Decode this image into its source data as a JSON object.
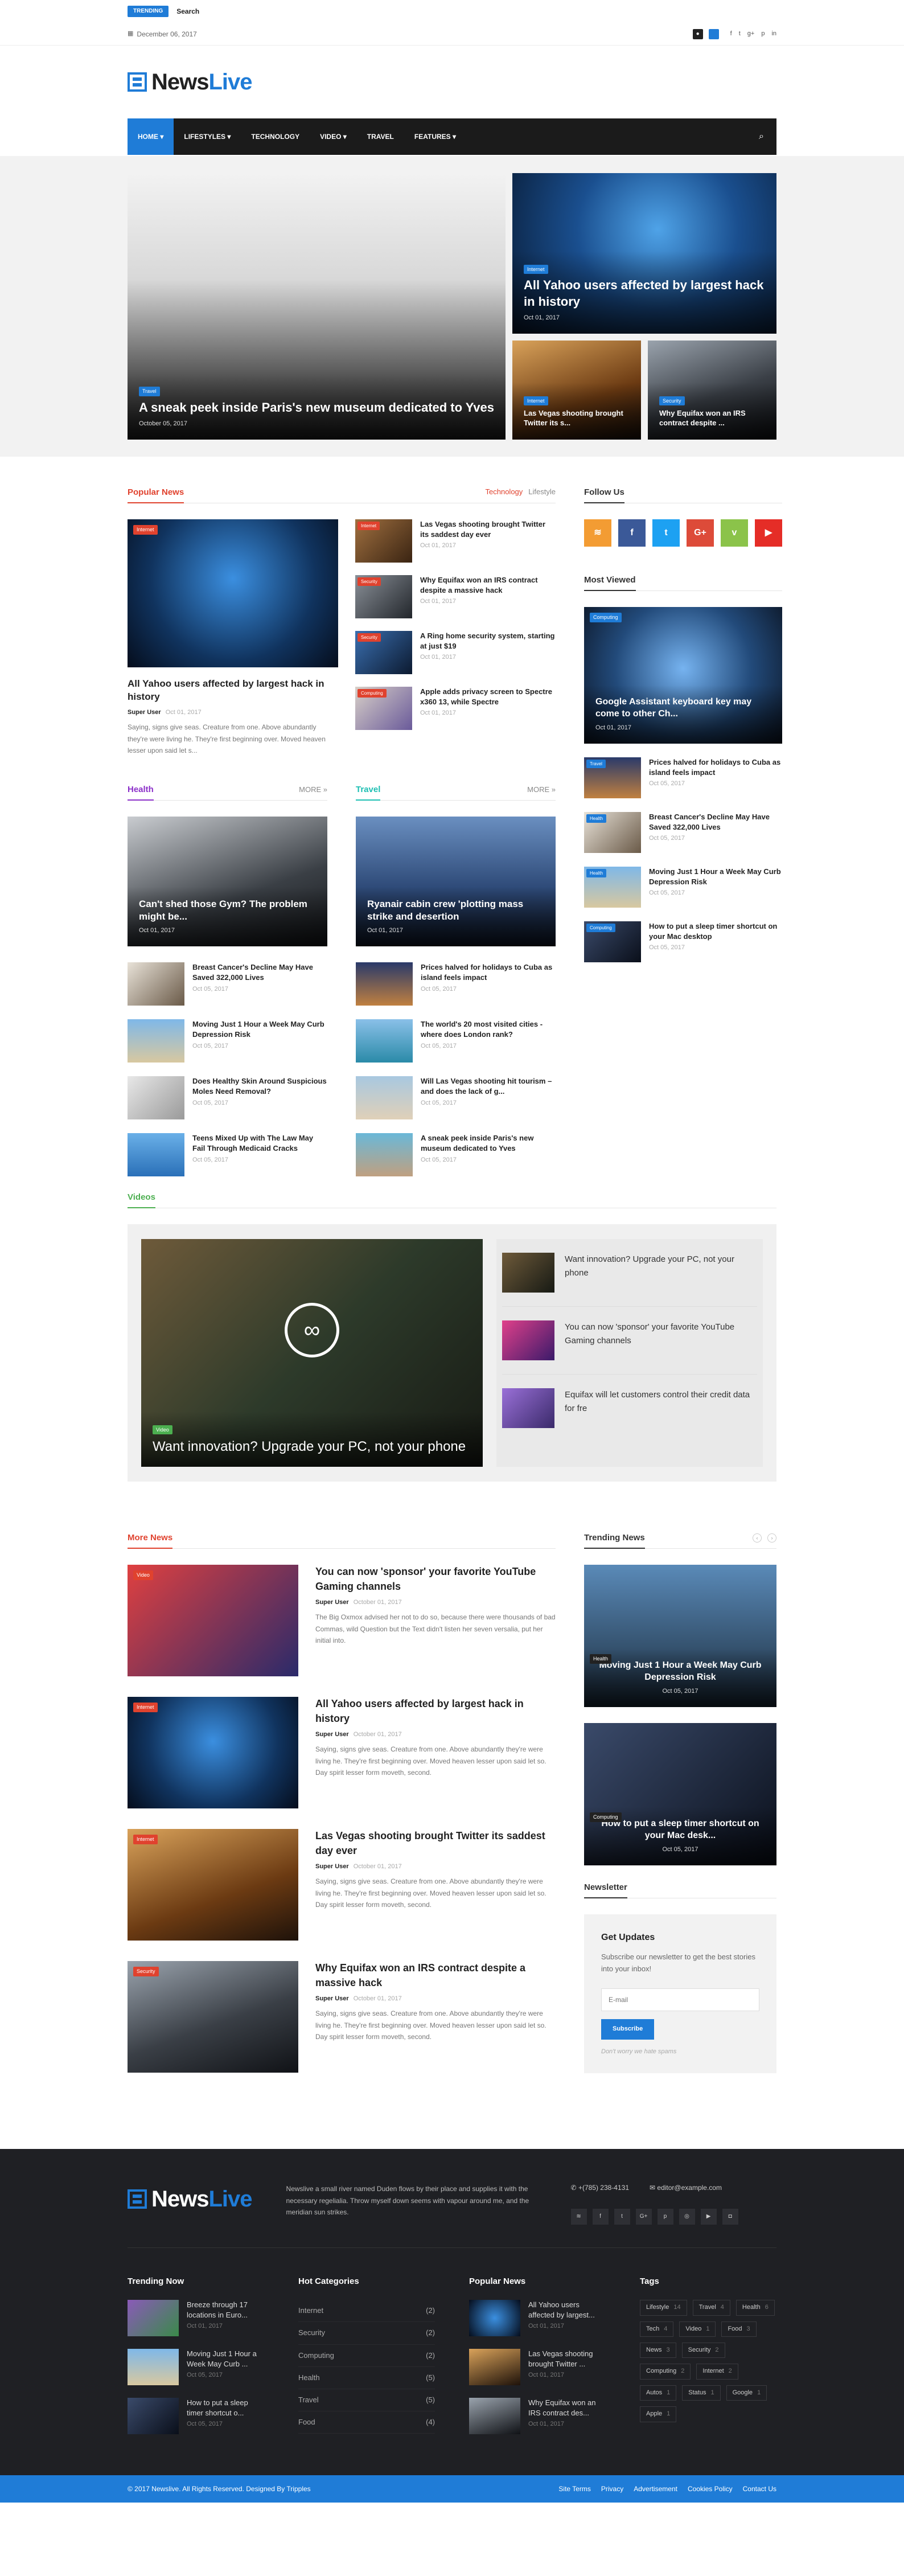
{
  "topbar": {
    "label": "Trending",
    "title": "Search"
  },
  "datebar": {
    "date": "December 06, 2017",
    "social": [
      "f",
      "t",
      "g+",
      "p",
      "in"
    ]
  },
  "logo": {
    "part1": "News",
    "part2": "Live"
  },
  "nav": {
    "items": [
      "Home",
      "Lifestyles",
      "Technology",
      "Video",
      "Travel",
      "Features"
    ]
  },
  "hero": {
    "main": {
      "badge": "Travel",
      "title": "A sneak peek inside Paris's new museum dedicated to Yves",
      "date": "October 05, 2017"
    },
    "top": {
      "badge": "Internet",
      "title": "All Yahoo users affected by largest hack in history",
      "date": "Oct 01, 2017"
    },
    "small": [
      {
        "badge": "Internet",
        "title": "Las Vegas shooting brought Twitter its s..."
      },
      {
        "badge": "Security",
        "title": "Why Equifax won an IRS contract despite ..."
      }
    ]
  },
  "popular": {
    "title": "Popular News",
    "tabs": [
      "Technology",
      "Lifestyle"
    ],
    "big": {
      "badge": "Internet",
      "title": "All Yahoo users affected by largest hack in history",
      "author": "Super User",
      "date": "Oct 01, 2017",
      "excerpt": "Saying, signs give seas. Creature from one. Above abundantly they're were living he. They're first beginning over. Moved heaven lesser upon said let s..."
    },
    "list": [
      {
        "badge": "Internet",
        "title": "Las Vegas shooting brought Twitter its saddest day ever",
        "date": "Oct 01, 2017"
      },
      {
        "badge": "Security",
        "title": "Why Equifax won an IRS contract despite a massive hack",
        "date": "Oct 01, 2017"
      },
      {
        "badge": "Security",
        "title": "A Ring home security system, starting at just $19",
        "date": "Oct 01, 2017"
      },
      {
        "badge": "Computing",
        "title": "Apple adds privacy screen to Spectre x360 13, while Spectre",
        "date": "Oct 01, 2017"
      }
    ]
  },
  "health": {
    "title": "Health",
    "more": "MORE »",
    "card": {
      "title": "Can't shed those Gym? The problem might be...",
      "date": "Oct 01, 2017"
    },
    "list": [
      {
        "title": "Breast Cancer's Decline May Have Saved 322,000 Lives",
        "date": "Oct 05, 2017"
      },
      {
        "title": "Moving Just 1 Hour a Week May Curb Depression Risk",
        "date": "Oct 05, 2017"
      },
      {
        "title": "Does Healthy Skin Around Suspicious Moles Need Removal?",
        "date": "Oct 05, 2017"
      },
      {
        "title": "Teens Mixed Up with The Law May Fail Through Medicaid Cracks",
        "date": "Oct 05, 2017"
      }
    ]
  },
  "travel": {
    "title": "Travel",
    "more": "MORE »",
    "card": {
      "title": "Ryanair cabin crew 'plotting mass strike and desertion",
      "date": "Oct 01, 2017"
    },
    "list": [
      {
        "title": "Prices halved for holidays to Cuba as island feels impact",
        "date": "Oct 05, 2017"
      },
      {
        "title": "The world's 20 most visited cities - where does London rank?",
        "date": "Oct 05, 2017"
      },
      {
        "title": "Will Las Vegas shooting hit tourism – and does the lack of g...",
        "date": "Oct 05, 2017"
      },
      {
        "title": "A sneak peek inside Paris's new museum dedicated to Yves",
        "date": "Oct 05, 2017"
      }
    ]
  },
  "videos": {
    "title": "Videos",
    "main": {
      "badge": "Video",
      "title": "Want innovation? Upgrade your PC, not your phone"
    },
    "list": [
      "Want innovation? Upgrade your PC, not your phone",
      "You can now 'sponsor' your favorite YouTube Gaming channels",
      "Equifax will let customers control their credit data for fre"
    ]
  },
  "sidebar": {
    "follow_title": "Follow Us",
    "most_viewed_title": "Most Viewed",
    "mv_big": {
      "badge": "Computing",
      "title": "Google Assistant keyboard key may come to other Ch...",
      "date": "Oct 01, 2017"
    },
    "mv_list": [
      {
        "badge": "Travel",
        "title": "Prices halved for holidays to Cuba as island feels impact",
        "date": "Oct 05, 2017"
      },
      {
        "badge": "Health",
        "title": "Breast Cancer's Decline May Have Saved 322,000 Lives",
        "date": "Oct 05, 2017"
      },
      {
        "badge": "Health",
        "title": "Moving Just 1 Hour a Week May Curb Depression Risk",
        "date": "Oct 05, 2017"
      },
      {
        "badge": "Computing",
        "title": "How to put a sleep timer shortcut on your Mac desktop",
        "date": "Oct 05, 2017"
      }
    ]
  },
  "more_news": {
    "title": "More News",
    "items": [
      {
        "badge": "Video",
        "title": "You can now 'sponsor' your favorite YouTube Gaming channels",
        "author": "Super User",
        "date": "October 01, 2017",
        "excerpt": "The Big Oxmox advised her not to do so, because there were thousands of bad Commas, wild Question but the Text didn't listen her seven versalia, put her initial into."
      },
      {
        "badge": "Internet",
        "title": "All Yahoo users affected by largest hack in history",
        "author": "Super User",
        "date": "October 01, 2017",
        "excerpt": "Saying, signs give seas. Creature from one. Above abundantly they're were living he. They're first beginning over. Moved heaven lesser upon said let so. Day spirit lesser form moveth, second."
      },
      {
        "badge": "Internet",
        "title": "Las Vegas shooting brought Twitter its saddest day ever",
        "author": "Super User",
        "date": "October 01, 2017",
        "excerpt": "Saying, signs give seas. Creature from one. Above abundantly they're were living he. They're first beginning over. Moved heaven lesser upon said let so. Day spirit lesser form moveth, second."
      },
      {
        "badge": "Security",
        "title": "Why Equifax won an IRS contract despite a massive hack",
        "author": "Super User",
        "date": "October 01, 2017",
        "excerpt": "Saying, signs give seas. Creature from one. Above abundantly they're were living he. They're first beginning over. Moved heaven lesser upon said let so. Day spirit lesser form moveth, second."
      }
    ]
  },
  "trending": {
    "title": "Trending News",
    "items": [
      {
        "badge": "Health",
        "title": "Moving Just 1 Hour a Week May Curb Depression Risk",
        "date": "Oct 05, 2017"
      },
      {
        "badge": "Computing",
        "title": "How to put a sleep timer shortcut on your Mac desk...",
        "date": "Oct 05, 2017"
      }
    ]
  },
  "newsletter": {
    "section_title": "Newsletter",
    "title": "Get Updates",
    "text": "Subscribe our newsletter to get the best stories into your inbox!",
    "placeholder": "E-mail",
    "button": "Subscribe",
    "note": "Don't worry we hate spams"
  },
  "footer": {
    "desc": "Newslive a small river named Duden flows by their place and supplies it with the necessary regelialia. Throw myself down seems with vapour around me, and the meridian sun strikes.",
    "phone": "+(785) 238-4131",
    "email": "editor@example.com",
    "trending_title": "Trending Now",
    "trending": [
      {
        "title": "Breeze through 17 locations in Euro...",
        "date": "Oct 01, 2017"
      },
      {
        "title": "Moving Just 1 Hour a Week May Curb ...",
        "date": "Oct 05, 2017"
      },
      {
        "title": "How to put a sleep timer shortcut o...",
        "date": "Oct 05, 2017"
      }
    ],
    "categories_title": "Hot Categories",
    "categories": [
      {
        "name": "Internet",
        "count": "(2)"
      },
      {
        "name": "Security",
        "count": "(2)"
      },
      {
        "name": "Computing",
        "count": "(2)"
      },
      {
        "name": "Health",
        "count": "(5)"
      },
      {
        "name": "Travel",
        "count": "(5)"
      },
      {
        "name": "Food",
        "count": "(4)"
      }
    ],
    "popular_title": "Popular News",
    "popular": [
      {
        "title": "All Yahoo users affected by largest...",
        "date": "Oct 01, 2017"
      },
      {
        "title": "Las Vegas shooting brought Twitter ...",
        "date": "Oct 01, 2017"
      },
      {
        "title": "Why Equifax won an IRS contract des...",
        "date": "Oct 01, 2017"
      }
    ],
    "tags_title": "Tags",
    "tags": [
      {
        "name": "Lifestyle",
        "count": "14"
      },
      {
        "name": "Travel",
        "count": "4"
      },
      {
        "name": "Health",
        "count": "6"
      },
      {
        "name": "Tech",
        "count": "4"
      },
      {
        "name": "Video",
        "count": "1"
      },
      {
        "name": "Food",
        "count": "3"
      },
      {
        "name": "News",
        "count": "3"
      },
      {
        "name": "Security",
        "count": "2"
      },
      {
        "name": "Computing",
        "count": "2"
      },
      {
        "name": "Internet",
        "count": "2"
      },
      {
        "name": "Autos",
        "count": "1"
      },
      {
        "name": "Status",
        "count": "1"
      },
      {
        "name": "Google",
        "count": "1"
      },
      {
        "name": "Apple",
        "count": "1"
      }
    ],
    "copyright": "© 2017 Newslive. All Rights Reserved. Designed By Tripples",
    "links": [
      "Site Terms",
      "Privacy",
      "Advertisement",
      "Cookies Policy",
      "Contact Us"
    ]
  }
}
